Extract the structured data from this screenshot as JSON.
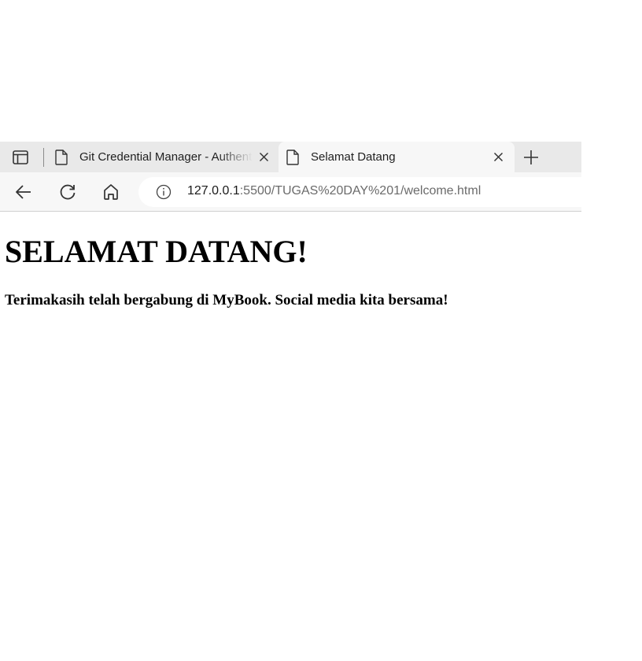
{
  "browser": {
    "tabs": [
      {
        "title": "Git Credential Manager - Authentication",
        "active": false
      },
      {
        "title": "Selamat Datang",
        "active": true
      }
    ],
    "address": {
      "host": "127.0.0.1",
      "path": ":5500/TUGAS%20DAY%201/welcome.html"
    },
    "icons": [
      "tab-actions-icon",
      "page-icon",
      "close-icon",
      "new-tab-icon",
      "back-icon",
      "reload-icon",
      "home-icon",
      "info-icon"
    ]
  },
  "page": {
    "heading": "SELAMAT DATANG!",
    "message": "Terimakasih telah bergabung di MyBook. Social media kita bersama!"
  }
}
